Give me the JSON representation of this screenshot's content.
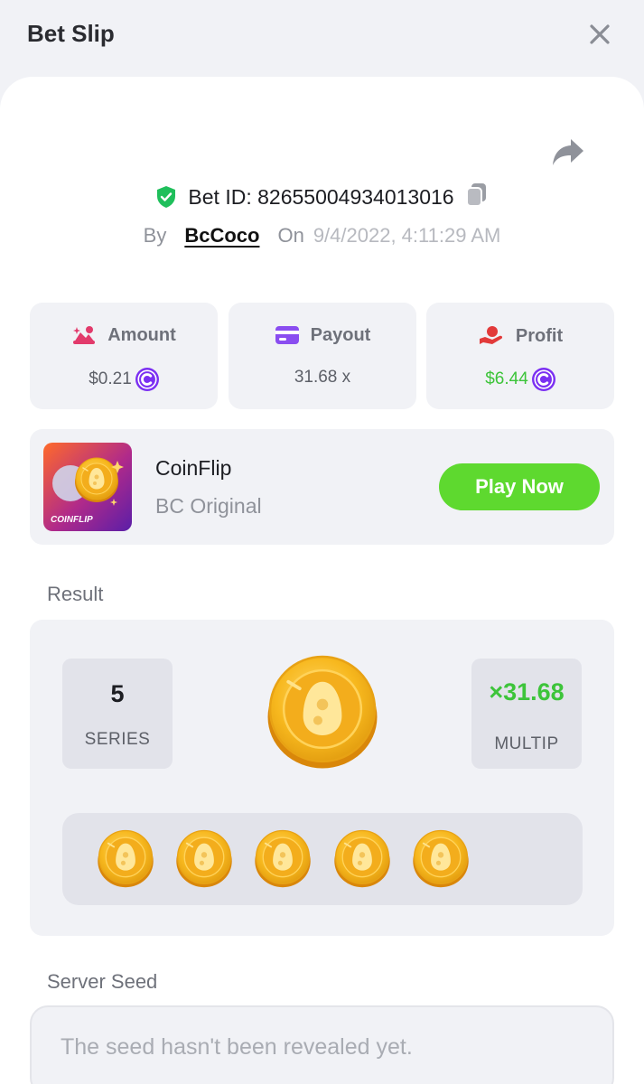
{
  "header": {
    "title": "Bet Slip"
  },
  "bet": {
    "id_label": "Bet ID: 82655004934013016",
    "by_label": "By",
    "user": "BcCoco",
    "on_label": "On",
    "date": "9/4/2022, 4:11:29 AM"
  },
  "stats": {
    "amount": {
      "label": "Amount",
      "value": "$0.21"
    },
    "payout": {
      "label": "Payout",
      "value": "31.68 x"
    },
    "profit": {
      "label": "Profit",
      "value": "$6.44"
    }
  },
  "game": {
    "name": "CoinFlip",
    "provider": "BC Original",
    "thumb_label": "COINFLIP",
    "play_label": "Play Now"
  },
  "result": {
    "label": "Result",
    "series_value": "5",
    "series_label": "SERIES",
    "multiplier_value": "×31.68",
    "multiplier_label": "MULTIP"
  },
  "server_seed": {
    "label": "Server Seed",
    "placeholder": "The seed hasn't been revealed yet."
  },
  "colors": {
    "accent_green": "#5ed92f",
    "profit_green": "#3dc43a",
    "coin_gold": "#f7b81e",
    "currency_purple": "#7b2ff2",
    "shield_green": "#1fbf5b"
  },
  "icons": [
    "close-icon",
    "share-icon",
    "shield-check-icon",
    "copy-icon",
    "amount-icon",
    "payout-card-icon",
    "profit-hand-icon",
    "bc-coin-icon",
    "coin-icon"
  ]
}
